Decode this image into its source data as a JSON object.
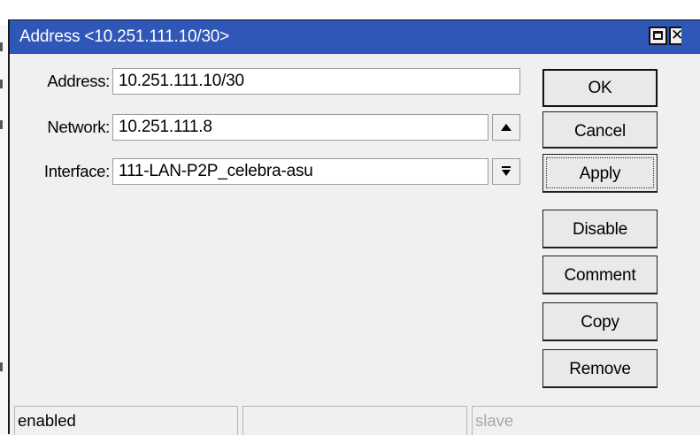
{
  "window": {
    "title": "Address <10.251.111.10/30>"
  },
  "form": {
    "address": {
      "label": "Address:",
      "value": "10.251.111.10/30"
    },
    "network": {
      "label": "Network:",
      "value": "10.251.111.8",
      "spin_icon": "triangle-up"
    },
    "interface": {
      "label": "Interface:",
      "value": "111-LAN-P2P_celebra-asu",
      "dropdown_icon": "arrow-down-to-bar"
    }
  },
  "buttons": {
    "ok": "OK",
    "cancel": "Cancel",
    "apply": "Apply",
    "disable": "Disable",
    "comment": "Comment",
    "copy": "Copy",
    "remove": "Remove"
  },
  "status": {
    "state": "enabled",
    "middle": "",
    "role": "slave"
  },
  "colors": {
    "titlebar": "#2f57b7",
    "window_bg": "#f0f0f0",
    "role_text": "#a8a8a8"
  }
}
